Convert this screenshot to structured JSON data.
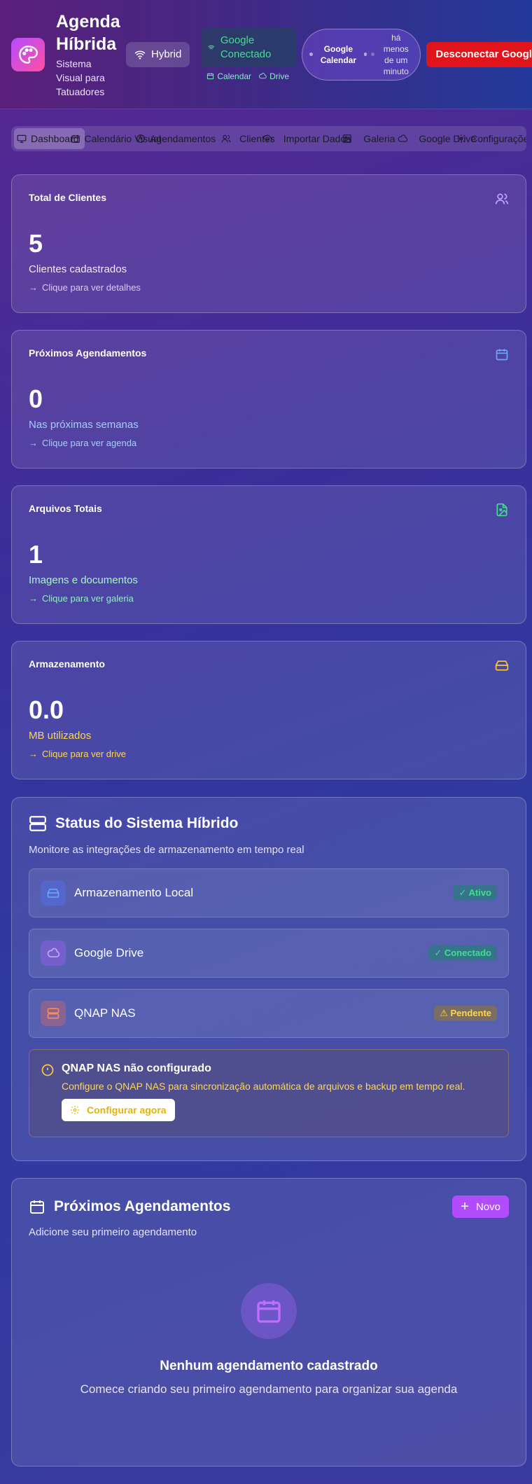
{
  "colors": {
    "accent": "#b24dff",
    "danger": "#e0141a",
    "success": "#3ee08a",
    "warning": "#ffd84a"
  },
  "header": {
    "logo_icon": "palette-icon",
    "title": "Agenda Híbrida",
    "subtitle": "Sistema Visual para Tatuadores",
    "hybrid_label": "Hybrid",
    "google_status": "Google Conectado",
    "google_services": [
      "Calendar",
      "Drive"
    ],
    "gcal_name": "Google Calendar",
    "gcal_sync_time": "há menos de um minuto",
    "disconnect_label": "Desconectar Google"
  },
  "nav": {
    "items": [
      {
        "label": "Dashboard",
        "icon": "monitor-icon"
      },
      {
        "label": "Calendário Visual",
        "icon": "calendar-icon"
      },
      {
        "label": "Agendamentos",
        "icon": "clock-icon"
      },
      {
        "label": "Clientes",
        "icon": "users-icon"
      },
      {
        "label": "Importar Dados",
        "icon": "upload-icon"
      },
      {
        "label": "Galeria",
        "icon": "image-icon"
      },
      {
        "label": "Google Drive",
        "icon": "cloud-icon"
      },
      {
        "label": "Configurações",
        "icon": "gear-icon"
      }
    ]
  },
  "stats": [
    {
      "title": "Total de Clientes",
      "value": "5",
      "label": "Clientes cadastrados",
      "link": "Clique para ver detalhes",
      "icon": "users-icon"
    },
    {
      "title": "Próximos Agendamentos",
      "value": "0",
      "label": "Nas próximas semanas",
      "link": "Clique para ver agenda",
      "icon": "calendar-icon"
    },
    {
      "title": "Arquivos Totais",
      "value": "1",
      "label": "Imagens e documentos",
      "link": "Clique para ver galeria",
      "icon": "file-image-icon"
    },
    {
      "title": "Armazenamento",
      "value": "0.0",
      "label": "MB utilizados",
      "link": "Clique para ver drive",
      "icon": "hard-drive-icon"
    }
  ],
  "system": {
    "title": "Status do Sistema Híbrido",
    "subtitle": "Monitore as integrações de armazenamento em tempo real",
    "rows": [
      {
        "label": "Armazenamento Local",
        "status": "✓ Ativo"
      },
      {
        "label": "Google Drive",
        "status": "✓ Conectado"
      },
      {
        "label": "QNAP NAS",
        "status": "⚠ Pendente"
      }
    ],
    "alert_title": "QNAP NAS não configurado",
    "alert_text": "Configure o QNAP NAS para sincronização automática de arquivos e backup em tempo real.",
    "alert_button": "Configurar agora"
  },
  "appointments": {
    "title": "Próximos Agendamentos",
    "new_label": "Novo",
    "subtitle": "Adicione seu primeiro agendamento",
    "empty_title": "Nenhum agendamento cadastrado",
    "empty_text": "Comece criando seu primeiro agendamento para organizar sua agenda"
  }
}
